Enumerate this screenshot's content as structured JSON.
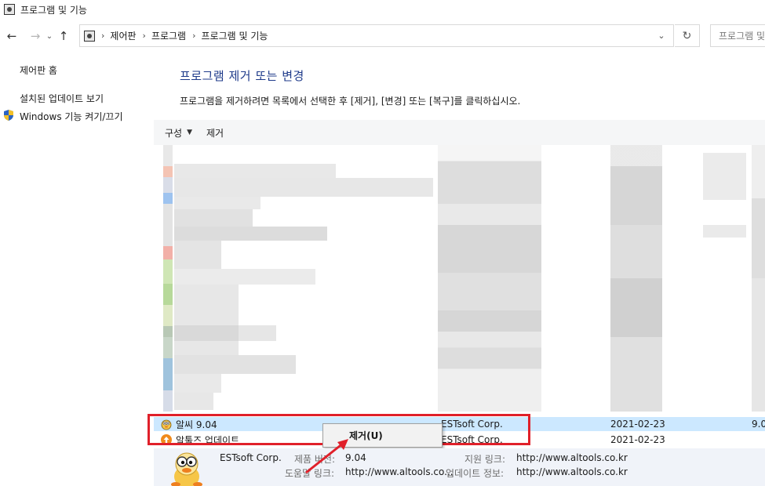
{
  "window": {
    "title": "프로그램 및 기능"
  },
  "address": {
    "crumbs": [
      "제어판",
      "프로그램",
      "프로그램 및 기능"
    ],
    "search_placeholder": "프로그램 및"
  },
  "left_pane": {
    "home": "제어판 홈",
    "installed_updates": "설치된 업데이트 보기",
    "windows_features": "Windows 기능 켜기/끄기"
  },
  "main": {
    "heading": "프로그램 제거 또는 변경",
    "instructions": "프로그램을 제거하려면 목록에서 선택한 후 [제거], [변경] 또는 [복구]를 클릭하십시오."
  },
  "toolbar": {
    "organize": "구성",
    "uninstall": "제거"
  },
  "programs": [
    {
      "name": "알씨 9.04",
      "publisher": "ESTsoft Corp.",
      "installed": "2021-02-23",
      "version": "9.0",
      "selected": true,
      "icon": "alsee-icon"
    },
    {
      "name": "알툴즈 업데이트",
      "publisher": "ESTsoft Corp.",
      "installed": "2021-02-23",
      "version": "",
      "selected": false,
      "icon": "altools-update-icon"
    }
  ],
  "context_menu": {
    "uninstall": "제거(U)"
  },
  "details": {
    "publisher": "ESTsoft Corp.",
    "product_version_label": "제품 버전:",
    "product_version": "9.04",
    "support_link_label": "지원 링크:",
    "support_link": "http://www.altools.co.kr",
    "help_link_label": "도움말 링크:",
    "help_link": "http://www.altools.co...",
    "update_info_label": "업데이트 정보:",
    "update_info": "http://www.altools.co.kr"
  },
  "colors": {
    "highlight": "#e0202a",
    "selected_row": "#cce8ff",
    "heading": "#1e3a8a"
  }
}
